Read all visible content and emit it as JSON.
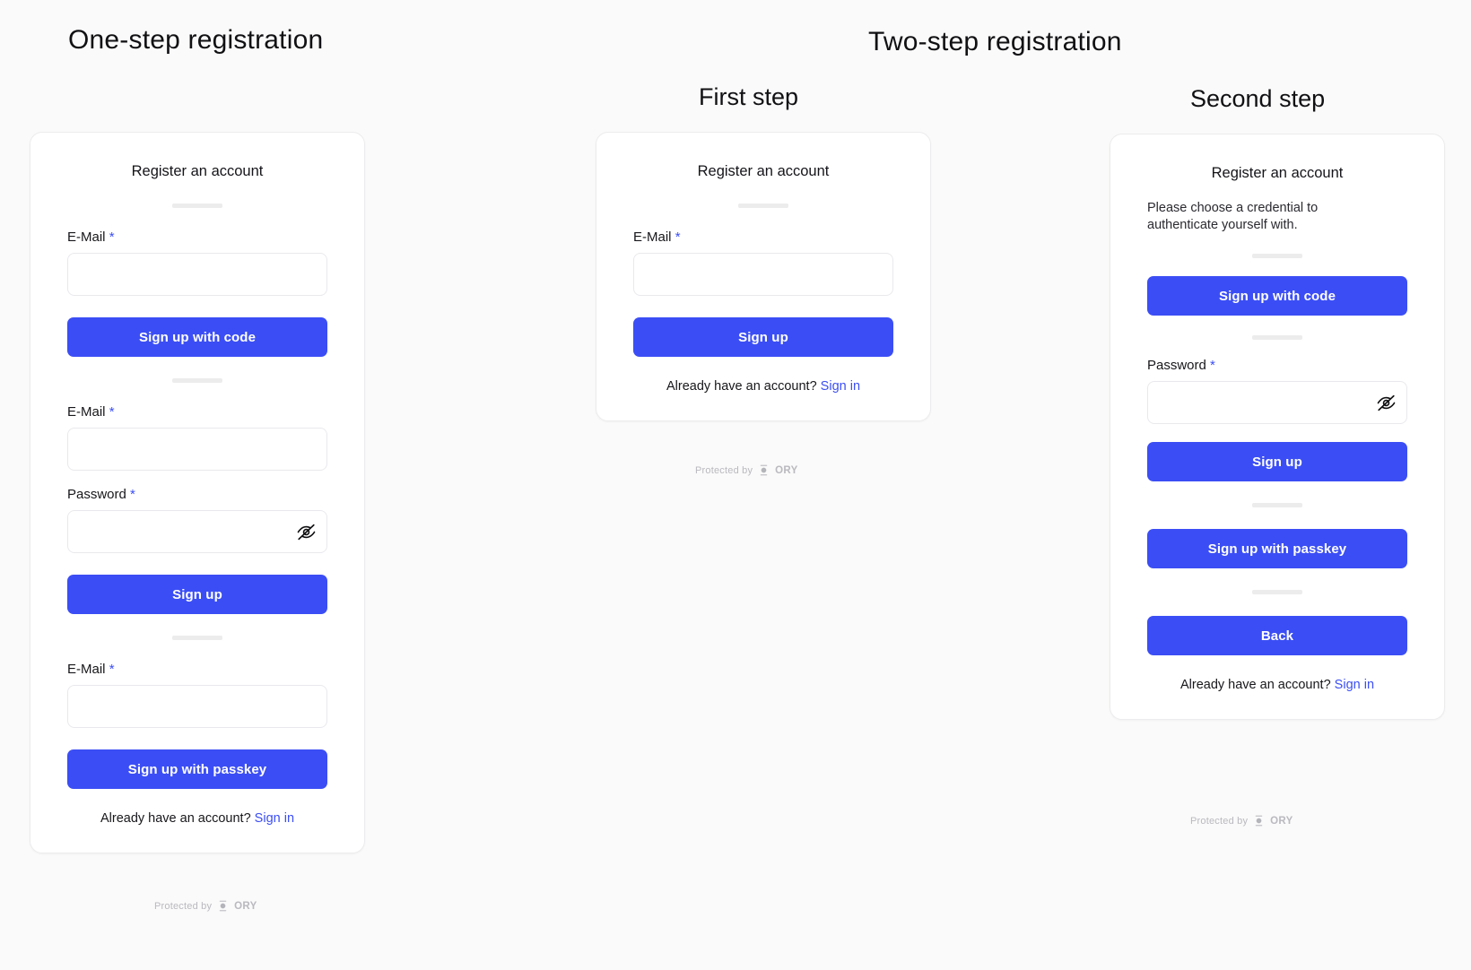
{
  "page": {
    "background_color": "#fafafa",
    "accent_color": "#3b4ef5",
    "headings": {
      "one_step": "One-step registration",
      "two_step": "Two-step registration",
      "first_step": "First step",
      "second_step": "Second step"
    }
  },
  "common": {
    "card_title": "Register an account",
    "email_label": "E-Mail",
    "password_label": "Password",
    "required_marker": "*",
    "email_value": "",
    "email_placeholder": "",
    "password_value": "",
    "password_placeholder": "",
    "have_account_text": "Already have an account?",
    "sign_in_label": "Sign in",
    "protected_by": "Protected by",
    "brand": "ORY",
    "reveal_password_icon": "eye-off-icon"
  },
  "one_step_card": {
    "title": "Register an account",
    "sections": [
      {
        "label": "E-Mail",
        "required": "*",
        "value": "",
        "button": "Sign up with code"
      },
      {
        "label": "E-Mail",
        "required": "*",
        "value": "",
        "password_label": "Password",
        "password_required": "*",
        "password_value": "",
        "button": "Sign up"
      },
      {
        "label": "E-Mail",
        "required": "*",
        "value": "",
        "button": "Sign up with passkey"
      }
    ],
    "have_account_text": "Already have an account?",
    "sign_in_label": "Sign in"
  },
  "first_step_card": {
    "title": "Register an account",
    "email_label": "E-Mail",
    "email_required": "*",
    "email_value": "",
    "submit_label": "Sign up",
    "have_account_text": "Already have an account?",
    "sign_in_label": "Sign in"
  },
  "second_step_card": {
    "title": "Register an account",
    "subtitle": "Please choose a credential to authenticate yourself with.",
    "code_button": "Sign up with code",
    "password_label": "Password",
    "password_required": "*",
    "password_value": "",
    "signup_button": "Sign up",
    "passkey_button": "Sign up with passkey",
    "back_button": "Back",
    "have_account_text": "Already have an account?",
    "sign_in_label": "Sign in"
  }
}
